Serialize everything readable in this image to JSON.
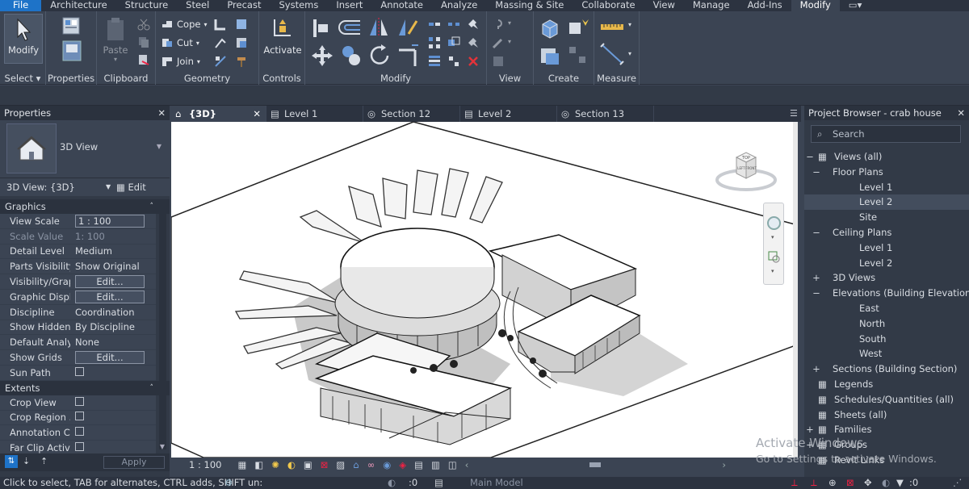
{
  "menu": {
    "tabs": [
      "File",
      "Architecture",
      "Structure",
      "Steel",
      "Precast",
      "Systems",
      "Insert",
      "Annotate",
      "Analyze",
      "Massing & Site",
      "Collaborate",
      "View",
      "Manage",
      "Add-Ins",
      "Modify"
    ],
    "active": "Modify"
  },
  "ribbon": {
    "modify_label": "Modify",
    "properties_label": "Properties",
    "paste_label": "Paste",
    "cope_label": "Cope",
    "cut_label": "Cut",
    "join_label": "Join",
    "activate_label": "Activate",
    "panels": {
      "select": "Select",
      "properties": "Properties",
      "clipboard": "Clipboard",
      "geometry": "Geometry",
      "controls": "Controls",
      "modify": "Modify",
      "view": "View",
      "create": "Create",
      "measure": "Measure"
    }
  },
  "properties": {
    "title": "Properties",
    "type_name": "3D View",
    "view_selector": "3D View: {3D}",
    "edit_type": "Edit Type",
    "sections": {
      "graphics": "Graphics",
      "extents": "Extents"
    },
    "graphics_rows": [
      {
        "key": "View Scale",
        "value": "1 : 100",
        "kind": "input"
      },
      {
        "key": "Scale Value",
        "value": "1:  100",
        "kind": "text",
        "dim": true
      },
      {
        "key": "Detail Level",
        "value": "Medium",
        "kind": "text"
      },
      {
        "key": "Parts Visibility",
        "value": "Show Original",
        "kind": "text"
      },
      {
        "key": "Visibility/Grap...",
        "value": "Edit...",
        "kind": "button"
      },
      {
        "key": "Graphic Displa...",
        "value": "Edit...",
        "kind": "button"
      },
      {
        "key": "Discipline",
        "value": "Coordination",
        "kind": "text"
      },
      {
        "key": "Show Hidden ...",
        "value": "By Discipline",
        "kind": "text"
      },
      {
        "key": "Default Analys...",
        "value": "None",
        "kind": "text"
      },
      {
        "key": "Show Grids",
        "value": "Edit...",
        "kind": "button"
      },
      {
        "key": "Sun Path",
        "value": "",
        "kind": "checkbox"
      }
    ],
    "extents_rows": [
      {
        "key": "Crop View",
        "value": "",
        "kind": "checkbox"
      },
      {
        "key": "Crop Region ...",
        "value": "",
        "kind": "checkbox"
      },
      {
        "key": "Annotation Cr...",
        "value": "",
        "kind": "checkbox"
      },
      {
        "key": "Far Clip Active",
        "value": "",
        "kind": "checkbox"
      }
    ],
    "apply_label": "Apply"
  },
  "view_tabs": [
    {
      "label": "{3D}",
      "icon": "house-icon",
      "active": true
    },
    {
      "label": "Level 1",
      "icon": "plan-icon",
      "active": false
    },
    {
      "label": "Section 12",
      "icon": "section-icon",
      "active": false
    },
    {
      "label": "Level 2",
      "icon": "plan-icon",
      "active": false
    },
    {
      "label": "Section 13",
      "icon": "section-icon",
      "active": false
    }
  ],
  "view_control": {
    "scale": "1 : 100"
  },
  "project_browser": {
    "title": "Project Browser - crab house",
    "search_placeholder": "Search",
    "items": [
      {
        "label": "Views (all)",
        "level": 0,
        "toggle": "−",
        "icon": true
      },
      {
        "label": "Floor Plans",
        "level": 1,
        "toggle": "−"
      },
      {
        "label": "Level 1",
        "level": 2
      },
      {
        "label": "Level 2",
        "level": 2,
        "selected": true
      },
      {
        "label": "Site",
        "level": 2
      },
      {
        "label": "Ceiling Plans",
        "level": 1,
        "toggle": "−"
      },
      {
        "label": "Level 1",
        "level": 2
      },
      {
        "label": "Level 2",
        "level": 2
      },
      {
        "label": "3D Views",
        "level": 1,
        "toggle": "+"
      },
      {
        "label": "Elevations (Building Elevation)",
        "level": 1,
        "toggle": "−"
      },
      {
        "label": "East",
        "level": 2
      },
      {
        "label": "North",
        "level": 2
      },
      {
        "label": "South",
        "level": 2
      },
      {
        "label": "West",
        "level": 2
      },
      {
        "label": "Sections (Building Section)",
        "level": 1,
        "toggle": "+"
      },
      {
        "label": "Legends",
        "level": 0,
        "icon": true
      },
      {
        "label": "Schedules/Quantities (all)",
        "level": 0,
        "icon": true
      },
      {
        "label": "Sheets (all)",
        "level": 0,
        "icon": true
      },
      {
        "label": "Families",
        "level": 0,
        "toggle": "+",
        "icon": true
      },
      {
        "label": "Groups",
        "level": 0,
        "toggle": "+",
        "icon": true
      },
      {
        "label": "Revit Links",
        "level": 0,
        "icon": true
      }
    ]
  },
  "viewcube": {
    "top": "TOP",
    "left": "LEFT",
    "front": "FRONT"
  },
  "status": {
    "hint": "Click to select, TAB for alternates, CTRL adds, SHIFT un:",
    "zero1": ":0",
    "model": "Main Model",
    "zero2": ":0"
  },
  "watermark": {
    "line1": "Activate Windows",
    "line2": "Go to Settings to activate Windows."
  }
}
